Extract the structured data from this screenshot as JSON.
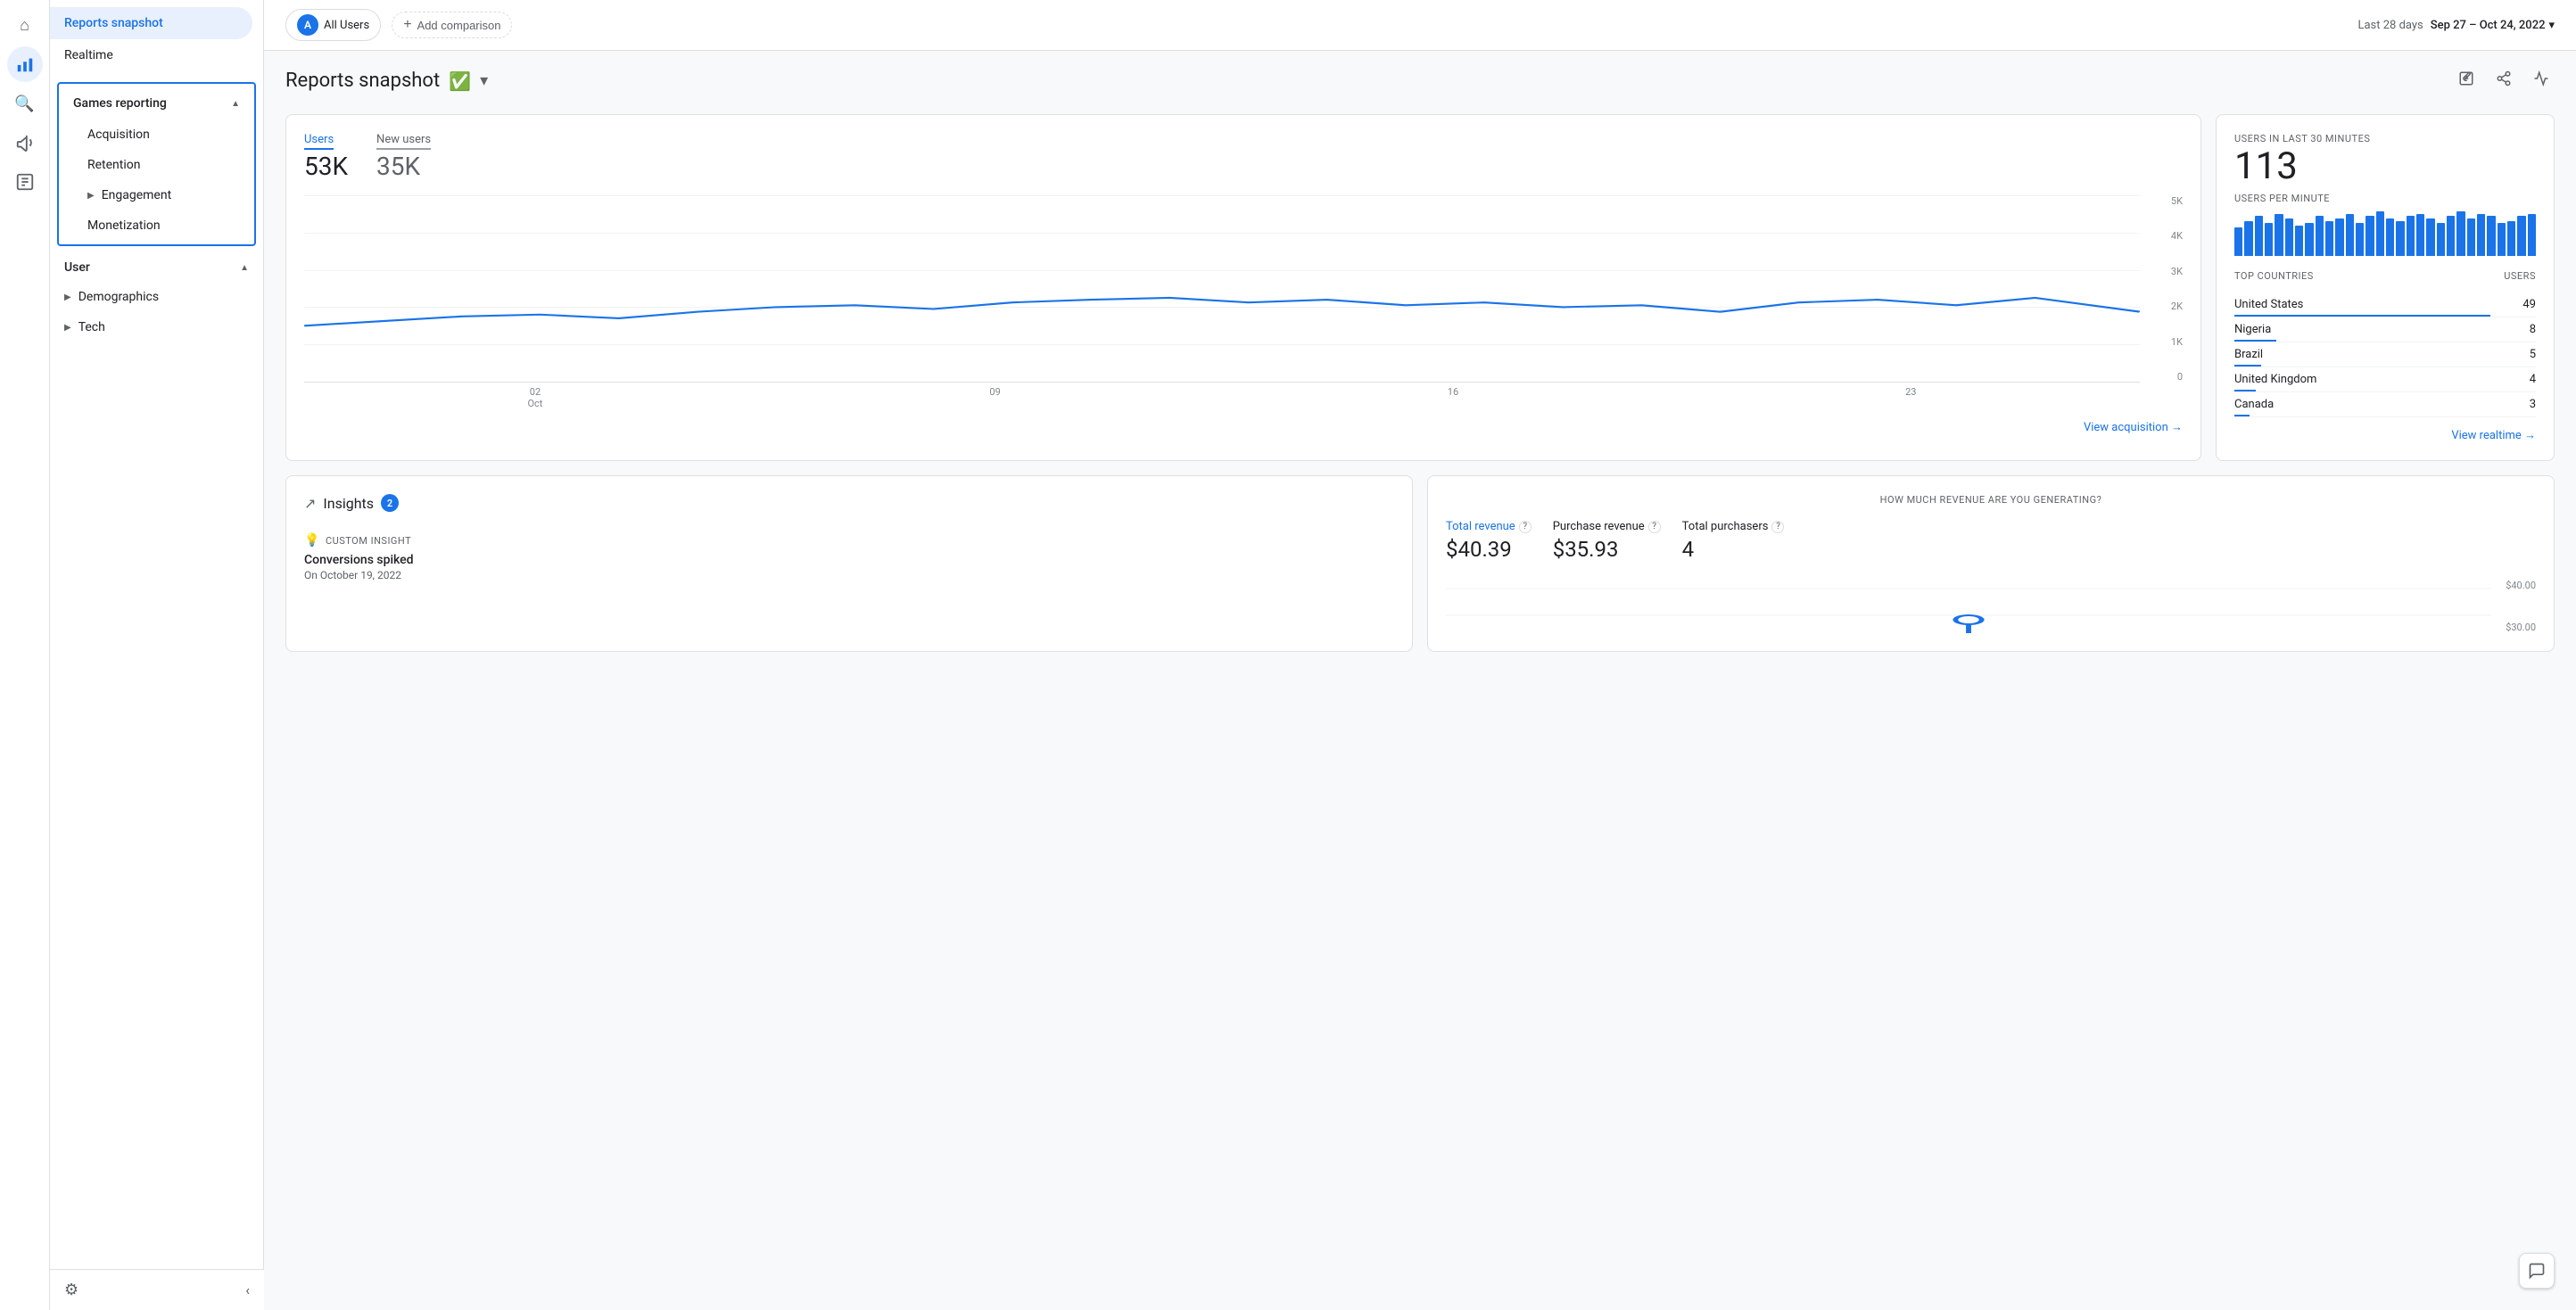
{
  "app": {
    "title": "Google Analytics"
  },
  "icon_rail": {
    "items": [
      {
        "name": "home-icon",
        "icon": "⌂",
        "active": false
      },
      {
        "name": "analytics-icon",
        "icon": "📊",
        "active": true
      },
      {
        "name": "search-icon",
        "icon": "🔍",
        "active": false
      },
      {
        "name": "megaphone-icon",
        "icon": "📢",
        "active": false
      },
      {
        "name": "reports-icon",
        "icon": "☰",
        "active": false
      }
    ]
  },
  "sidebar": {
    "reports_snapshot_label": "Reports snapshot",
    "realtime_label": "Realtime",
    "games_reporting_label": "Games reporting",
    "acquisition_label": "Acquisition",
    "retention_label": "Retention",
    "engagement_label": "Engagement",
    "monetization_label": "Monetization",
    "user_label": "User",
    "demographics_label": "Demographics",
    "tech_label": "Tech",
    "settings_icon": "⚙",
    "collapse_label": "‹"
  },
  "topbar": {
    "user_chip": "All Users",
    "user_avatar": "A",
    "add_comparison_label": "Add comparison",
    "date_prefix": "Last 28 days",
    "date_range": "Sep 27 – Oct 24, 2022",
    "dropdown_icon": "▾"
  },
  "page_title": {
    "title": "Reports snapshot",
    "check_icon": "✓",
    "dropdown_icon": "▾"
  },
  "users_card": {
    "users_label": "Users",
    "users_value": "53K",
    "new_users_label": "New users",
    "new_users_value": "35K",
    "y_labels": [
      "5K",
      "4K",
      "3K",
      "2K",
      "1K",
      "0"
    ],
    "x_labels": [
      {
        "date": "02",
        "month": "Oct"
      },
      {
        "date": "09",
        "month": ""
      },
      {
        "date": "16",
        "month": ""
      },
      {
        "date": "23",
        "month": ""
      }
    ],
    "view_link": "View acquisition →"
  },
  "realtime_card": {
    "header_label": "USERS IN LAST 30 MINUTES",
    "value": "113",
    "per_minute_label": "USERS PER MINUTE",
    "bar_heights": [
      60,
      75,
      85,
      70,
      90,
      80,
      65,
      70,
      85,
      75,
      80,
      90,
      70,
      85,
      95,
      80,
      75,
      85,
      90,
      80,
      70,
      85,
      95,
      80,
      90,
      85,
      70,
      75,
      85,
      90
    ],
    "countries_header_left": "TOP COUNTRIES",
    "countries_header_right": "USERS",
    "countries": [
      {
        "name": "United States",
        "value": 49,
        "bar_pct": 85
      },
      {
        "name": "Nigeria",
        "value": 8,
        "bar_pct": 14
      },
      {
        "name": "Brazil",
        "value": 5,
        "bar_pct": 9
      },
      {
        "name": "United Kingdom",
        "value": 4,
        "bar_pct": 7
      },
      {
        "name": "Canada",
        "value": 3,
        "bar_pct": 5
      }
    ],
    "view_link": "View realtime →"
  },
  "insights_card": {
    "title": "Insights",
    "badge": "2",
    "insight_icon": "↗",
    "insight_type": "CUSTOM INSIGHT",
    "insight_title": "Conversions spiked",
    "insight_date": "On October 19, 2022"
  },
  "revenue_card": {
    "question": "HOW MUCH REVENUE ARE YOU GENERATING?",
    "total_revenue_label": "Total revenue",
    "total_revenue_value": "$40.39",
    "purchase_revenue_label": "Purchase revenue",
    "purchase_revenue_value": "$35.93",
    "total_purchasers_label": "Total purchasers",
    "total_purchasers_value": "4",
    "y_labels": [
      "$40.00",
      "$30.00"
    ],
    "help_icon": "?"
  }
}
